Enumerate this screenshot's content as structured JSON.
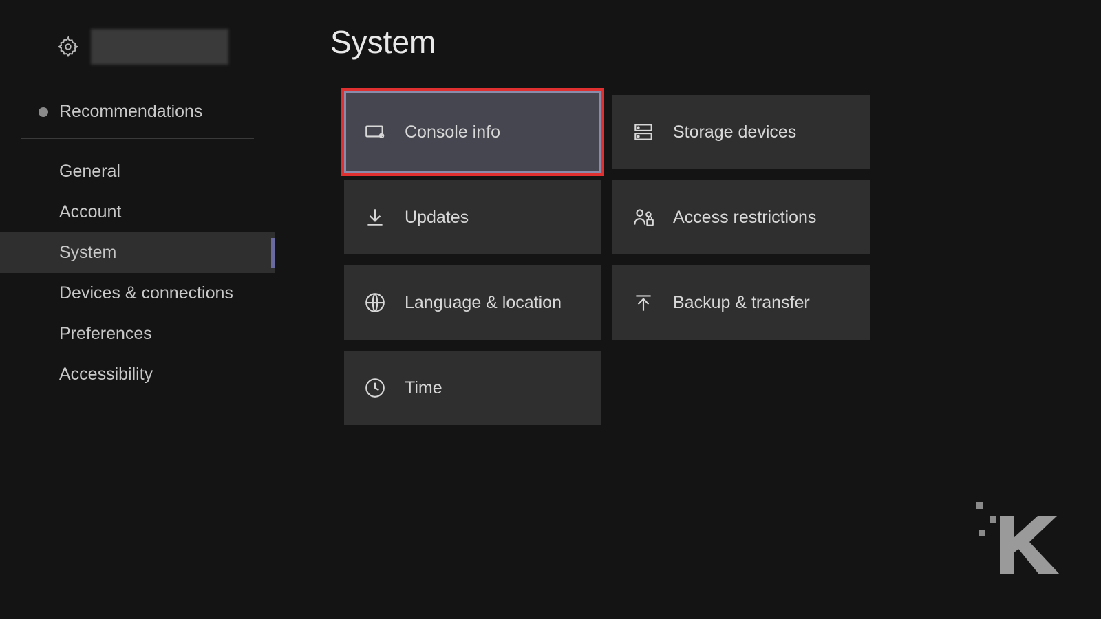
{
  "sidebar": {
    "recommendations_label": "Recommendations",
    "items": [
      {
        "label": "General",
        "selected": false
      },
      {
        "label": "Account",
        "selected": false
      },
      {
        "label": "System",
        "selected": true
      },
      {
        "label": "Devices & connections",
        "selected": false
      },
      {
        "label": "Preferences",
        "selected": false
      },
      {
        "label": "Accessibility",
        "selected": false
      }
    ]
  },
  "main": {
    "title": "System",
    "tiles": [
      {
        "label": "Console info",
        "icon": "console-icon",
        "highlighted": true
      },
      {
        "label": "Storage devices",
        "icon": "storage-icon",
        "highlighted": false
      },
      {
        "label": "Updates",
        "icon": "download-icon",
        "highlighted": false
      },
      {
        "label": "Access restrictions",
        "icon": "access-icon",
        "highlighted": false
      },
      {
        "label": "Language & location",
        "icon": "globe-icon",
        "highlighted": false
      },
      {
        "label": "Backup & transfer",
        "icon": "upload-icon",
        "highlighted": false
      },
      {
        "label": "Time",
        "icon": "clock-icon",
        "highlighted": false
      }
    ]
  }
}
